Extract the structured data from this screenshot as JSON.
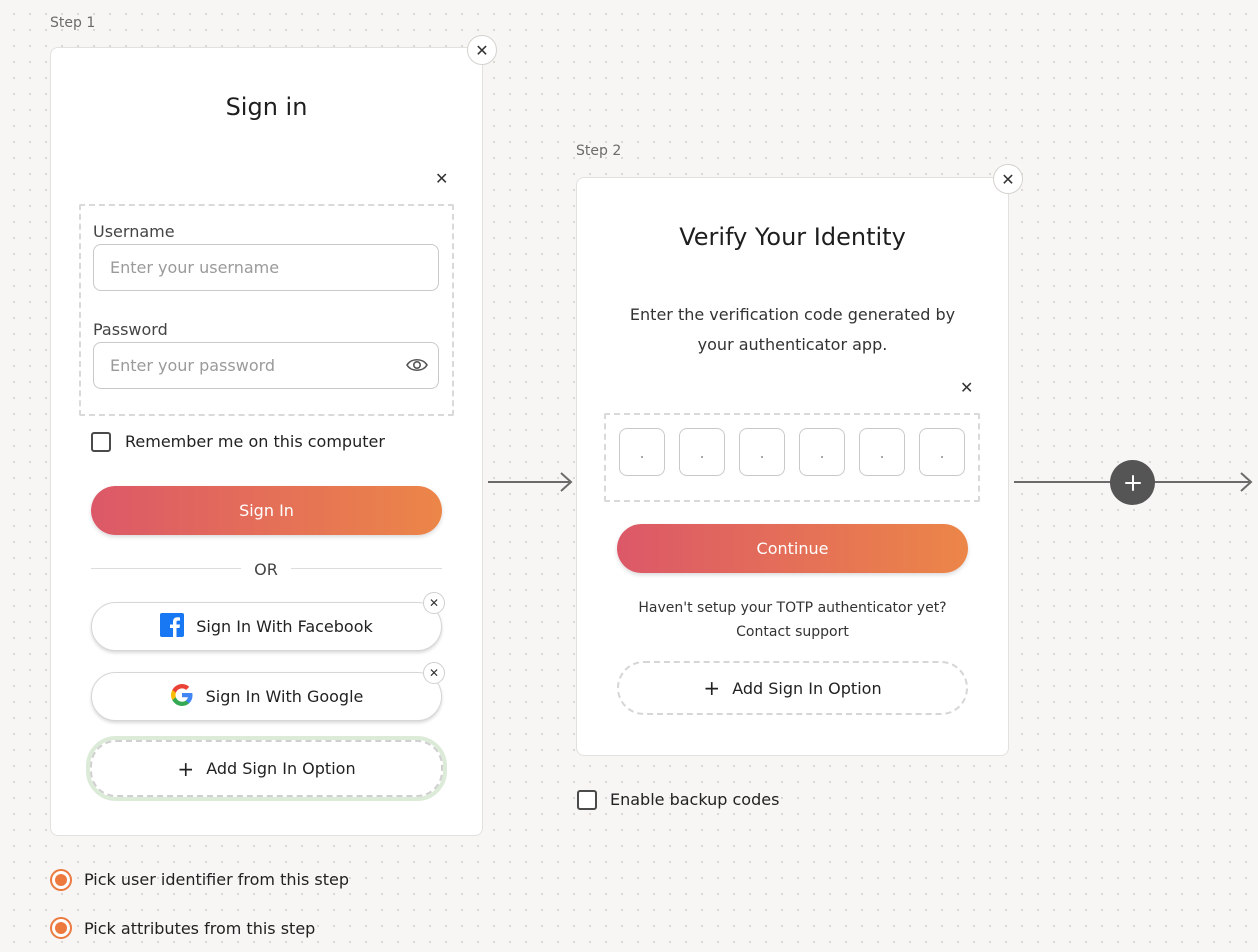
{
  "step1": {
    "label": "Step 1",
    "title": "Sign in",
    "username": {
      "label": "Username",
      "placeholder": "Enter your username"
    },
    "password": {
      "label": "Password",
      "placeholder": "Enter your password"
    },
    "remember_label": "Remember me on this computer",
    "sign_in_label": "Sign In",
    "or_label": "OR",
    "facebook_label": "Sign In With Facebook",
    "google_label": "Sign In With Google",
    "add_option_label": "Add Sign In Option"
  },
  "step2": {
    "label": "Step 2",
    "title": "Verify Your Identity",
    "description_line1": "Enter the verification code generated by",
    "description_line2": "your authenticator app.",
    "otp_placeholder": ".",
    "continue_label": "Continue",
    "help_line1": "Haven't setup your TOTP authenticator yet?",
    "help_line2": "Contact support",
    "add_option_label": "Add Sign In Option",
    "backup_codes_label": "Enable backup codes"
  },
  "options": {
    "pick_identifier": "Pick user identifier from this step",
    "pick_attributes": "Pick attributes from this step"
  },
  "colors": {
    "accent_start": "#dc5868",
    "accent_end": "#ec8648",
    "radio": "#ec7a3f",
    "node": "#555555"
  }
}
